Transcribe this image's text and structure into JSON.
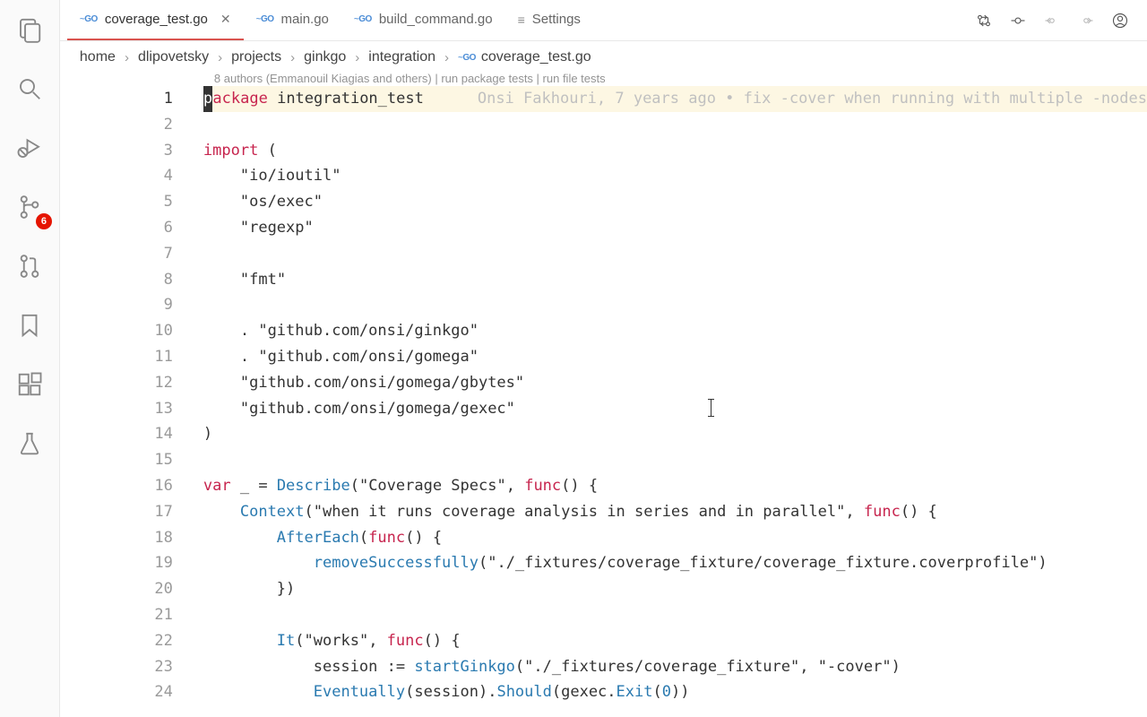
{
  "activity": {
    "scm_badge": "6"
  },
  "tabs": [
    {
      "label": "coverage_test.go",
      "type": "go",
      "active": true,
      "closeable": true
    },
    {
      "label": "main.go",
      "type": "go",
      "active": false
    },
    {
      "label": "build_command.go",
      "type": "go",
      "active": false
    },
    {
      "label": "Settings",
      "type": "settings",
      "active": false
    }
  ],
  "breadcrumb": [
    {
      "label": "home"
    },
    {
      "label": "dlipovetsky"
    },
    {
      "label": "projects"
    },
    {
      "label": "ginkgo"
    },
    {
      "label": "integration"
    },
    {
      "label": "coverage_test.go",
      "go": true
    }
  ],
  "codelens": {
    "authors": "8 authors (Emmanouil Kiagias and others)",
    "pkg_tests": "run package tests",
    "file_tests": "run file tests"
  },
  "blame_annotation": "Onsi Fakhouri, 7 years ago • fix -cover when running with multiple -nodes",
  "line_numbers": [
    "1",
    "2",
    "3",
    "4",
    "5",
    "6",
    "7",
    "8",
    "9",
    "10",
    "11",
    "12",
    "13",
    "14",
    "15",
    "16",
    "17",
    "18",
    "19",
    "20",
    "21",
    "22",
    "23",
    "24"
  ],
  "code": {
    "l1_kw": "package",
    "l1_pkg": "integration_test",
    "l3_kw": "import",
    "imports": {
      "ioutil": "io/ioutil",
      "osexec": "os/exec",
      "regexp": "regexp",
      "fmt": "fmt",
      "ginkgo": "github.com/onsi/ginkgo",
      "gomega": "github.com/onsi/gomega",
      "gbytes": "github.com/onsi/gomega/gbytes",
      "gexec": "github.com/onsi/gomega/gexec"
    },
    "l16_kw": "var",
    "l16_describe": "Describe",
    "l16_str": "\"Coverage Specs\"",
    "l16_func": "func",
    "l17_context": "Context",
    "l17_str": "\"when it runs coverage analysis in series and in parallel\"",
    "l17_func": "func",
    "l18_after": "AfterEach",
    "l18_func": "func",
    "l19_remove": "removeSuccessfully",
    "l19_str": "\"./_fixtures/coverage_fixture/coverage_fixture.coverprofile\"",
    "l22_it": "It",
    "l22_str": "\"works\"",
    "l22_func": "func",
    "l23_start": "startGinkgo",
    "l23_str1": "\"./_fixtures/coverage_fixture\"",
    "l23_str2": "\"-cover\"",
    "l24_eventually": "Eventually",
    "l24_should": "Should",
    "l24_exit": "Exit",
    "l24_num": "0"
  }
}
